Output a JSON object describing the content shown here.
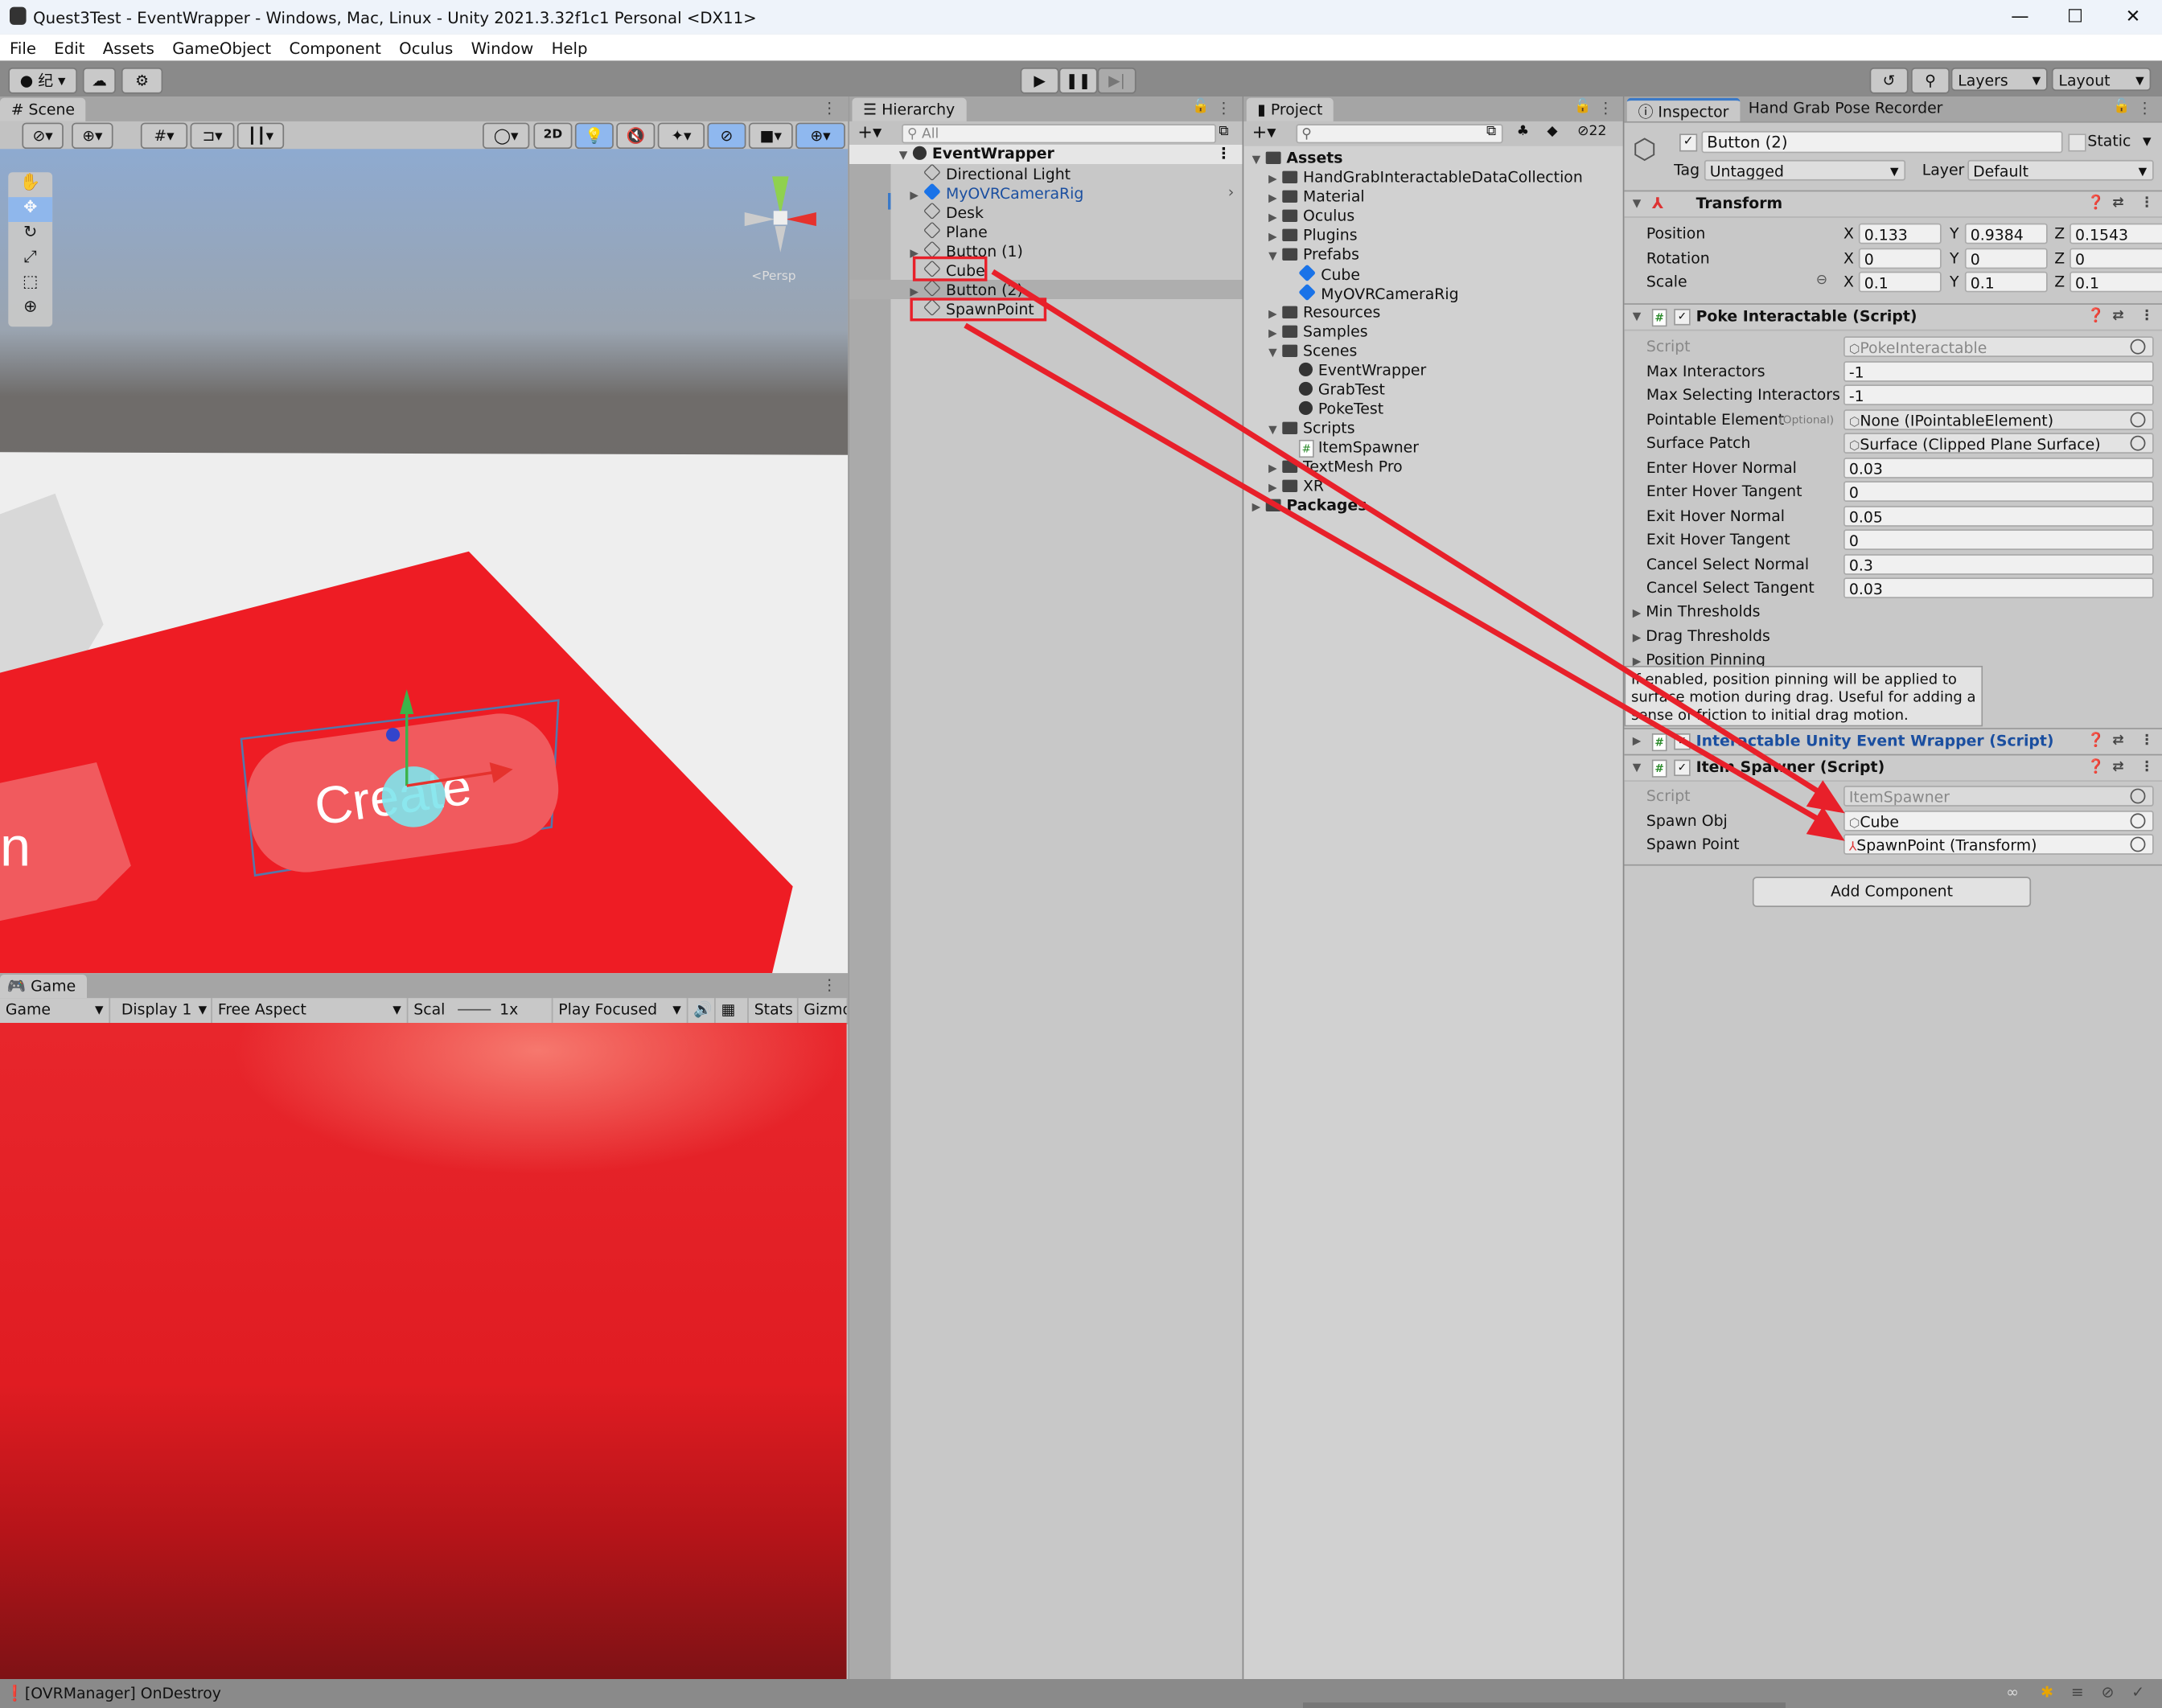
{
  "window": {
    "title": "Quest3Test - EventWrapper - Windows, Mac, Linux - Unity 2021.3.32f1c1 Personal <DX11>",
    "minimize": "—",
    "maximize": "☐",
    "close": "✕"
  },
  "menu": [
    "File",
    "Edit",
    "Assets",
    "GameObject",
    "Component",
    "Oculus",
    "Window",
    "Help"
  ],
  "toolbar": {
    "account_glyph": "纪",
    "layers": "Layers",
    "layout": "Layout"
  },
  "scene": {
    "tab": "Scene",
    "btn_2d": "2D",
    "gizmo_label": "<Persp",
    "button_text": "Create"
  },
  "game": {
    "tab": "Game",
    "mode": "Game",
    "display": "Display 1",
    "aspect": "Free Aspect",
    "scale_label": "Scal",
    "scale_value": "1x",
    "play_mode": "Play Focused",
    "stats": "Stats",
    "gizmos": "Gizmo"
  },
  "hierarchy": {
    "tab": "Hierarchy",
    "search_placeholder": "All",
    "scene": "EventWrapper",
    "items": [
      {
        "label": "Directional Light",
        "expand": false
      },
      {
        "label": "MyOVRCameraRig",
        "expand": true,
        "prefab": true
      },
      {
        "label": "Desk",
        "expand": false
      },
      {
        "label": "Plane",
        "expand": false
      },
      {
        "label": "Button (1)",
        "expand": true
      },
      {
        "label": "Cube",
        "expand": false,
        "highlighted": true
      },
      {
        "label": "Button (2)",
        "expand": true,
        "selected": true
      },
      {
        "label": "SpawnPoint",
        "expand": false,
        "highlighted": true
      }
    ]
  },
  "project": {
    "tab": "Project",
    "hidden_count": "22",
    "items": [
      {
        "label": "Assets",
        "depth": 0,
        "type": "folder",
        "open": true,
        "bold": true
      },
      {
        "label": "HandGrabInteractableDataCollection",
        "depth": 1,
        "type": "folder"
      },
      {
        "label": "Material",
        "depth": 1,
        "type": "folder"
      },
      {
        "label": "Oculus",
        "depth": 1,
        "type": "folder"
      },
      {
        "label": "Plugins",
        "depth": 1,
        "type": "folder"
      },
      {
        "label": "Prefabs",
        "depth": 1,
        "type": "folder",
        "open": true
      },
      {
        "label": "Cube",
        "depth": 2,
        "type": "prefab"
      },
      {
        "label": "MyOVRCameraRig",
        "depth": 2,
        "type": "prefab"
      },
      {
        "label": "Resources",
        "depth": 1,
        "type": "folder"
      },
      {
        "label": "Samples",
        "depth": 1,
        "type": "folder"
      },
      {
        "label": "Scenes",
        "depth": 1,
        "type": "folder",
        "open": true
      },
      {
        "label": "EventWrapper",
        "depth": 2,
        "type": "scene"
      },
      {
        "label": "GrabTest",
        "depth": 2,
        "type": "scene"
      },
      {
        "label": "PokeTest",
        "depth": 2,
        "type": "scene"
      },
      {
        "label": "Scripts",
        "depth": 1,
        "type": "folder",
        "open": true
      },
      {
        "label": "ItemSpawner",
        "depth": 2,
        "type": "script"
      },
      {
        "label": "TextMesh Pro",
        "depth": 1,
        "type": "folder"
      },
      {
        "label": "XR",
        "depth": 1,
        "type": "folder"
      },
      {
        "label": "Packages",
        "depth": 0,
        "type": "folder",
        "bold": true
      }
    ]
  },
  "inspector": {
    "tab": "Inspector",
    "tab2": "Hand Grab Pose Recorder",
    "name": "Button (2)",
    "static": "Static",
    "tag_label": "Tag",
    "tag": "Untagged",
    "layer_label": "Layer",
    "layer": "Default",
    "transform": {
      "title": "Transform",
      "position": {
        "label": "Position",
        "x": "0.133",
        "y": "0.9384",
        "z": "0.1543"
      },
      "rotation": {
        "label": "Rotation",
        "x": "0",
        "y": "0",
        "z": "0"
      },
      "scale": {
        "label": "Scale",
        "x": "0.1",
        "y": "0.1",
        "z": "0.1"
      }
    },
    "poke": {
      "title": "Poke Interactable (Script)",
      "optional": "(Optional)",
      "fields": [
        {
          "label": "Script",
          "value": "PokeInteractable",
          "ro": true,
          "obj": true
        },
        {
          "label": "Max Interactors",
          "value": "-1"
        },
        {
          "label": "Max Selecting Interactors",
          "value": "-1"
        },
        {
          "label": "Pointable Element",
          "value": "None (IPointableElement)",
          "obj": true
        },
        {
          "label": "Surface Patch",
          "value": "Surface (Clipped Plane Surface)",
          "obj": true
        },
        {
          "label": "Enter Hover Normal",
          "value": "0.03"
        },
        {
          "label": "Enter Hover Tangent",
          "value": "0"
        },
        {
          "label": "Exit Hover Normal",
          "value": "0.05"
        },
        {
          "label": "Exit Hover Tangent",
          "value": "0"
        },
        {
          "label": "Cancel Select Normal",
          "value": "0.3"
        },
        {
          "label": "Cancel Select Tangent",
          "value": "0.03"
        }
      ],
      "foldouts": [
        "Min Thresholds",
        "Drag Thresholds",
        "Position Pinning"
      ]
    },
    "tooltip": "If enabled, position pinning will be applied to surface motion during drag. Useful for adding a sense of friction to initial drag motion.",
    "wrapper": {
      "title": "Interactable Unity Event Wrapper (Script)"
    },
    "spawner": {
      "title": "Item Spawner (Script)",
      "fields": [
        {
          "label": "Script",
          "value": "ItemSpawner",
          "ro": true
        },
        {
          "label": "Spawn Obj",
          "value": "Cube"
        },
        {
          "label": "Spawn Point",
          "value": "SpawnPoint (Transform)"
        }
      ]
    },
    "add_component": "Add Component"
  },
  "status": {
    "message": "[OVRManager] OnDestroy"
  },
  "colors": {
    "annotation": "#e8202a",
    "selection": "#3a79c8",
    "scene_red": "#ee1c24"
  }
}
